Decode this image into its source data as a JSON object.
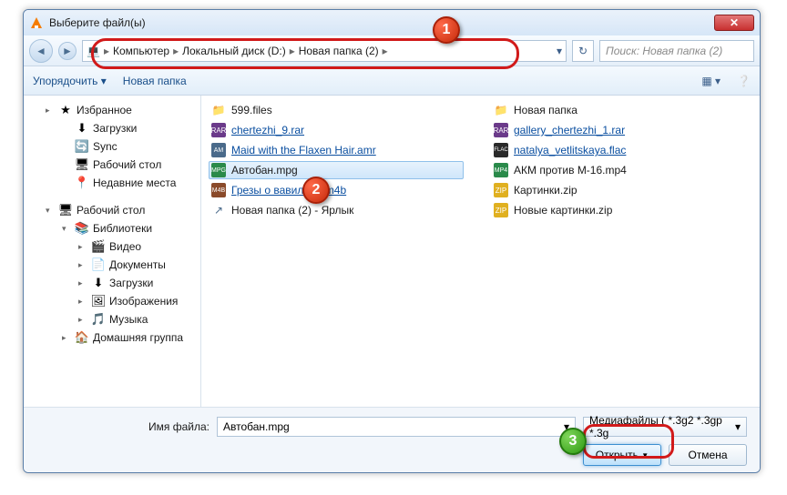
{
  "window": {
    "title": "Выберите файл(ы)"
  },
  "breadcrumb": {
    "root_icon": "computer",
    "items": [
      "Компьютер",
      "Локальный диск (D:)",
      "Новая папка (2)"
    ]
  },
  "search": {
    "placeholder": "Поиск: Новая папка (2)"
  },
  "toolbar": {
    "organize": "Упорядочить",
    "newfolder": "Новая папка"
  },
  "sidebar": [
    {
      "level": 1,
      "icon": "star",
      "label": "Избранное",
      "caret": "▸"
    },
    {
      "level": 2,
      "icon": "dl",
      "label": "Загрузки"
    },
    {
      "level": 2,
      "icon": "sync",
      "label": "Sync"
    },
    {
      "level": 2,
      "icon": "desk",
      "label": "Рабочий стол"
    },
    {
      "level": 2,
      "icon": "recent",
      "label": "Недавние места"
    },
    {
      "sep": true
    },
    {
      "level": 1,
      "icon": "desk",
      "label": "Рабочий стол",
      "caret": "▾"
    },
    {
      "level": 2,
      "icon": "lib",
      "label": "Библиотеки",
      "caret": "▾"
    },
    {
      "level": 3,
      "icon": "video",
      "label": "Видео",
      "caret": "▸"
    },
    {
      "level": 3,
      "icon": "doc",
      "label": "Документы",
      "caret": "▸"
    },
    {
      "level": 3,
      "icon": "dl",
      "label": "Загрузки",
      "caret": "▸"
    },
    {
      "level": 3,
      "icon": "img",
      "label": "Изображения",
      "caret": "▸"
    },
    {
      "level": 3,
      "icon": "music",
      "label": "Музыка",
      "caret": "▸"
    },
    {
      "level": 2,
      "icon": "home",
      "label": "Домашняя группа",
      "caret": "▸"
    }
  ],
  "files_left": [
    {
      "icon": "folder",
      "name": "599.files",
      "link": false
    },
    {
      "icon": "rar",
      "name": "chertezhi_9.rar",
      "link": true
    },
    {
      "icon": "amr",
      "name": "Maid with the Flaxen Hair.amr",
      "link": true
    },
    {
      "icon": "mpg",
      "name": "Автобан.mpg",
      "link": false,
      "selected": true
    },
    {
      "icon": "m4b",
      "name": "Грезы о вавилоне.m4b",
      "link": true
    },
    {
      "icon": "lnk",
      "name": "Новая папка (2) - Ярлык",
      "link": false
    }
  ],
  "files_right": [
    {
      "icon": "folder",
      "name": "Новая папка",
      "link": false
    },
    {
      "icon": "rar",
      "name": "gallery_chertezhi_1.rar",
      "link": true
    },
    {
      "icon": "flac",
      "name": "natalya_vetlitskaya.flac",
      "link": true
    },
    {
      "icon": "mp4",
      "name": "АКМ против М-16.mp4",
      "link": false
    },
    {
      "icon": "zip",
      "name": "Картинки.zip",
      "link": false
    },
    {
      "icon": "zip",
      "name": "Новые картинки.zip",
      "link": false
    }
  ],
  "bottom": {
    "filename_label": "Имя файла:",
    "filename_value": "Автобан.mpg",
    "filetype": "Медиафайлы ( *.3g2 *.3gp *.3g",
    "open": "Открыть",
    "cancel": "Отмена"
  },
  "callouts": {
    "c1": "1",
    "c2": "2",
    "c3": "3"
  },
  "icon_text": {
    "folder": "📁",
    "star": "★",
    "dl": "⬇",
    "sync": "🔄",
    "desk": "🖥",
    "recent": "📍",
    "lib": "📚",
    "video": "🎬",
    "doc": "📄",
    "img": "🖼",
    "music": "🎵",
    "home": "🏠",
    "rar": "RAR",
    "zip": "ZIP",
    "mpg": "MPG",
    "mp4": "MP4",
    "m4b": "M4B",
    "flac": "FLAC",
    "amr": "AM",
    "lnk": "↗",
    "comp": "💻"
  }
}
